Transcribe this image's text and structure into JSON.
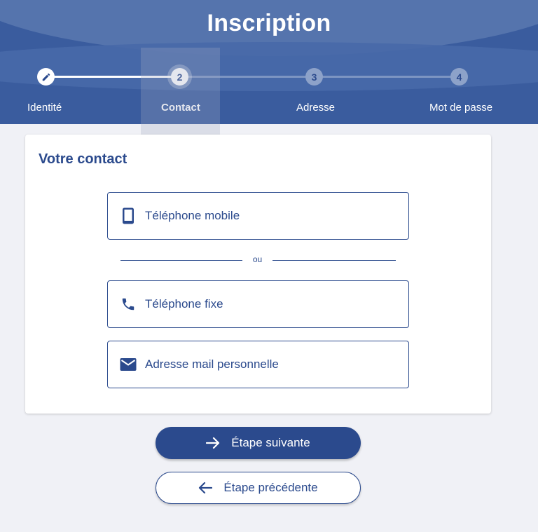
{
  "header": {
    "title": "Inscription"
  },
  "stepper": {
    "steps": [
      {
        "label": "Identité",
        "number": "",
        "state": "done",
        "icon": "pencil-icon"
      },
      {
        "label": "Contact",
        "number": "2",
        "state": "current"
      },
      {
        "label": "Adresse",
        "number": "3",
        "state": "todo"
      },
      {
        "label": "Mot de passe",
        "number": "4",
        "state": "todo"
      }
    ]
  },
  "card": {
    "title": "Votre contact",
    "options": [
      {
        "label": "Téléphone mobile",
        "icon": "smartphone-icon"
      },
      {
        "label": "Téléphone fixe",
        "icon": "phone-icon"
      },
      {
        "label": "Adresse mail personnelle",
        "icon": "mail-icon"
      }
    ],
    "separator": "ou"
  },
  "actions": {
    "next_label": "Étape suivante",
    "prev_label": "Étape précédente"
  },
  "colors": {
    "brand": "#2b4a8d",
    "header_bg": "#3a5c9e",
    "page_bg": "#f0f1f6"
  }
}
